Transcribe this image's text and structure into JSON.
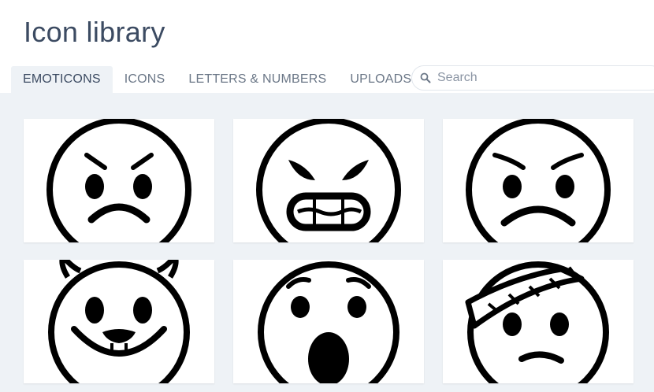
{
  "header": {
    "title": "Icon library"
  },
  "tabs": [
    {
      "label": "EMOTICONS",
      "active": true
    },
    {
      "label": "ICONS",
      "active": false
    },
    {
      "label": "LETTERS & NUMBERS",
      "active": false
    },
    {
      "label": "UPLOADS",
      "active": false
    }
  ],
  "search": {
    "placeholder": "Search",
    "value": "",
    "icon": "search-icon"
  },
  "icons": [
    {
      "name": "angry-face-icon"
    },
    {
      "name": "grimacing-angry-face-icon"
    },
    {
      "name": "frowning-face-icon"
    },
    {
      "name": "devil-face-icon"
    },
    {
      "name": "shocked-face-icon"
    },
    {
      "name": "bandaged-face-icon"
    }
  ],
  "colors": {
    "title": "#3c4b62",
    "tab_inactive": "#6b7787",
    "tab_active_bg": "#eef2f6",
    "content_bg": "#eef2f6",
    "card_bg": "#ffffff",
    "icon_stroke": "#000000"
  }
}
